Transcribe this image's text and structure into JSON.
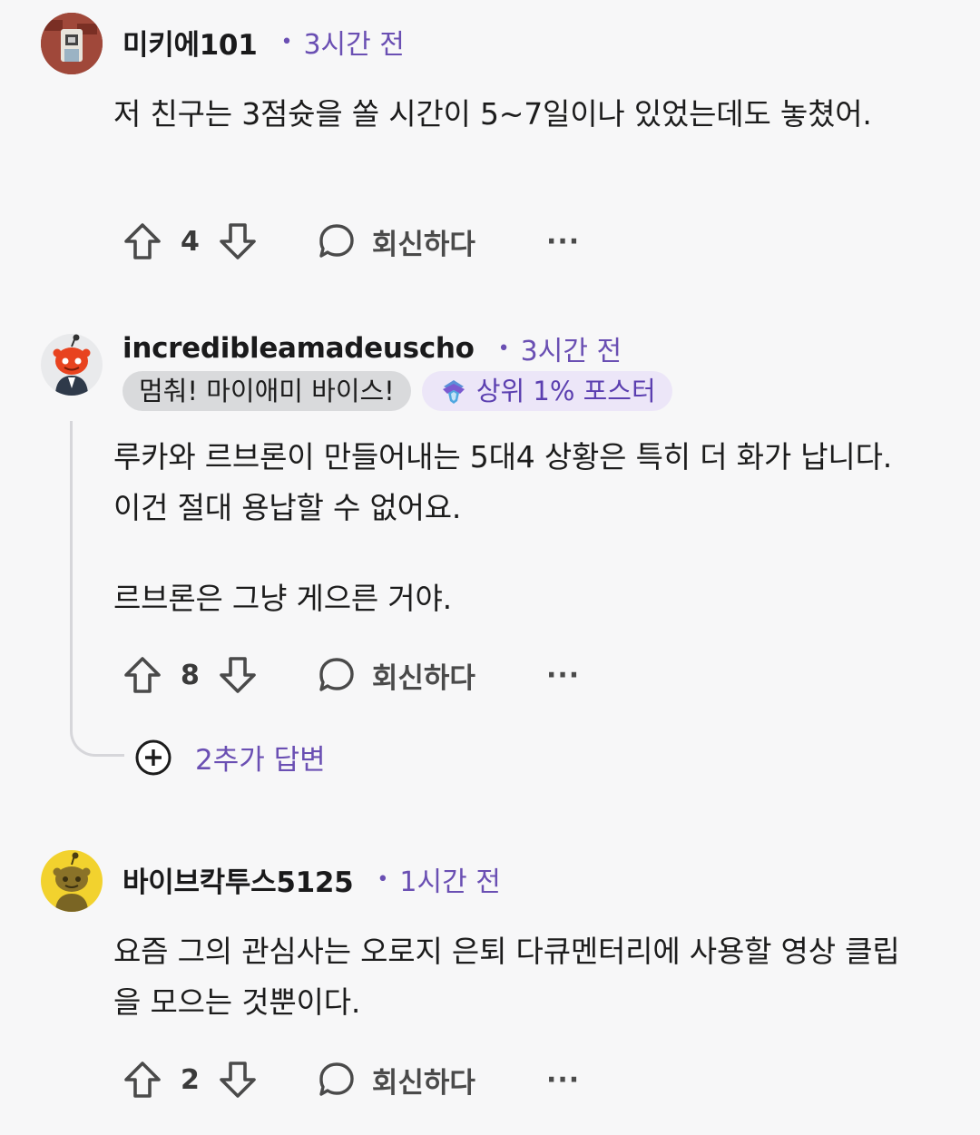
{
  "comments": [
    {
      "username": "미키에101",
      "time": "3시간 전",
      "body": [
        "저 친구는 3점슛을 쏠 시간이 5~7일이나 있었는데도 놓쳤어."
      ],
      "votes": "4",
      "reply_label": "회신하다",
      "more_label": "···"
    },
    {
      "username": "incredibleamadeuscho",
      "time": "3시간 전",
      "flair_user": "멈춰! 마이애미 바이스!",
      "flair_badge": "상위 1% 포스터",
      "body": [
        "루카와 르브론이 만들어내는 5대4 상황은 특히 더 화가 납니다. 이건 절대 용납할 수 없어요.",
        "르브론은 그냥 게으른 거야."
      ],
      "votes": "8",
      "reply_label": "회신하다",
      "more_label": "···",
      "more_replies_label": "2추가 답변"
    },
    {
      "username": "바이브칵투스5125",
      "time": "1시간 전",
      "body": [
        "요즘 그의 관심사는 오로지 은퇴 다큐멘터리에 사용할 영상 클립을 모으는 것뿐이다."
      ],
      "votes": "2",
      "reply_label": "회신하다",
      "more_label": "···"
    }
  ],
  "colors": {
    "accent": "#6a4fb3",
    "background": "#f7f7f8",
    "flair_gray": "#d9dadc",
    "flair_purple_bg": "#ece6f8"
  },
  "icons": [
    "upvote-icon",
    "downvote-icon",
    "comment-bubble-icon",
    "more-icon",
    "plus-circle-icon",
    "badge-icon",
    "avatar-icon"
  ]
}
